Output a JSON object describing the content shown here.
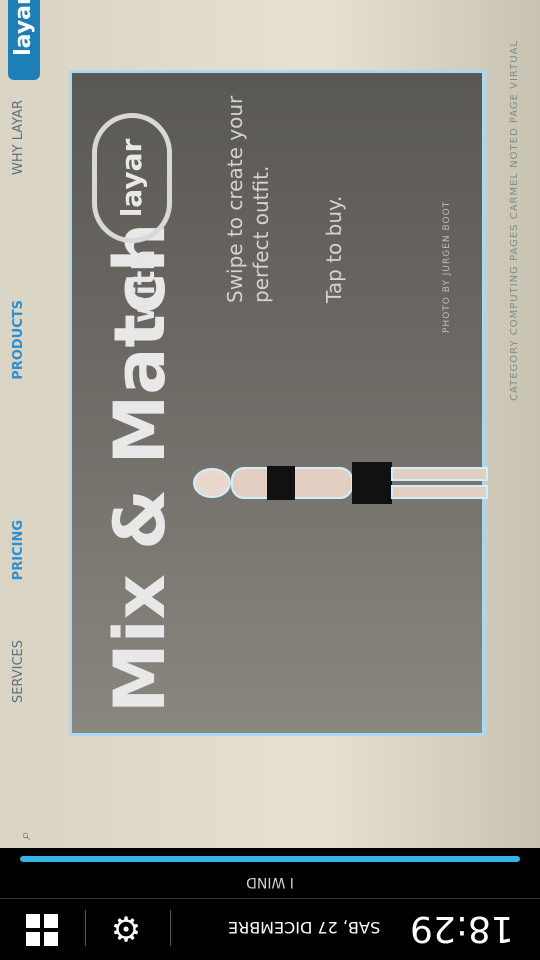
{
  "site": {
    "logo": "layar",
    "nav": [
      {
        "label": "WHY LAYAR"
      },
      {
        "label": "PRODUCTS"
      },
      {
        "label": "PRICING"
      },
      {
        "label": "SERVICES"
      }
    ],
    "category_line": "CATEGORY   COMPUTING   PAGES   CARMEL NOTED   PAGE VIRTUAL"
  },
  "banner": {
    "title": "Mix & Match",
    "with": "with",
    "badge": "layar",
    "swipe": "Swipe to create your perfect outfit.",
    "tap": "Tap to buy.",
    "footer": "PHOTO BY JURGEN BOOT"
  },
  "status": {
    "carrier": "I WIND",
    "time": "18:29",
    "date": "SAB, 27 DICEMBRE",
    "progress_fraction": 1.0
  }
}
